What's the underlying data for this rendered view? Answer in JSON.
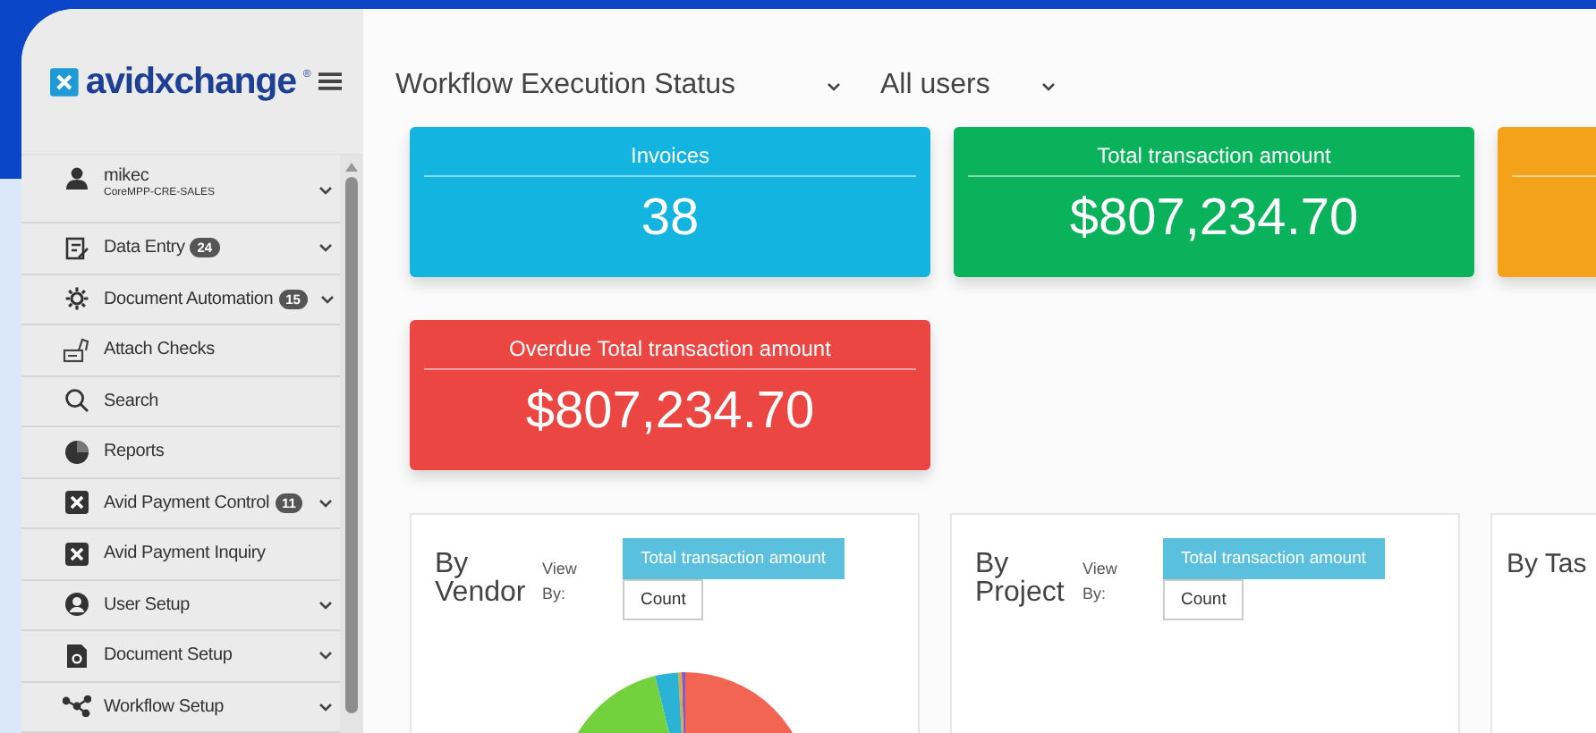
{
  "logo": {
    "text": "avidxchange",
    "mark": "®"
  },
  "sidebar": {
    "items": [
      {
        "kind": "user",
        "label": "mikec",
        "subtitle": "CoreMPP-CRE-SALES",
        "has_submenu": true
      },
      {
        "kind": "data-entry",
        "label": "Data Entry",
        "badge": "24",
        "has_submenu": true
      },
      {
        "kind": "gear",
        "label": "Document Automation",
        "badge": "15",
        "has_submenu": true
      },
      {
        "kind": "check",
        "label": "Attach Checks",
        "has_submenu": false
      },
      {
        "kind": "search",
        "label": "Search",
        "has_submenu": false
      },
      {
        "kind": "reports",
        "label": "Reports",
        "has_submenu": false
      },
      {
        "kind": "xbox",
        "label": "Avid Payment Control",
        "badge": "11",
        "has_submenu": true
      },
      {
        "kind": "xbox",
        "label": "Avid Payment Inquiry",
        "has_submenu": false
      },
      {
        "kind": "person",
        "label": "User Setup",
        "has_submenu": true
      },
      {
        "kind": "document",
        "label": "Document Setup",
        "has_submenu": true
      },
      {
        "kind": "workflow",
        "label": "Workflow Setup",
        "has_submenu": true
      }
    ]
  },
  "filters": [
    {
      "label": "Workflow Execution Status"
    },
    {
      "label": "All users"
    }
  ],
  "cards": [
    {
      "title": "Invoices",
      "value": "38",
      "color": "#13b5e0"
    },
    {
      "title": "Total transaction amount",
      "value": "$807,234.70",
      "color": "#0ab25c"
    },
    {
      "color": "#f5a21b"
    },
    {
      "title": "Overdue Total transaction amount",
      "value": "$807,234.70",
      "color": "#ec4642"
    }
  ],
  "panels": [
    {
      "title": "By Vendor",
      "view_by_label": "View By:",
      "options": [
        {
          "label": "Total transaction amount",
          "selected": true
        },
        {
          "label": "Count",
          "selected": false
        }
      ],
      "has_pie": true
    },
    {
      "title": "By Project",
      "view_by_label": "View By:",
      "options": [
        {
          "label": "Total transaction amount",
          "selected": true
        },
        {
          "label": "Count",
          "selected": false
        }
      ],
      "has_pie": false
    },
    {
      "title": "By Tas",
      "has_pie": false
    }
  ]
}
